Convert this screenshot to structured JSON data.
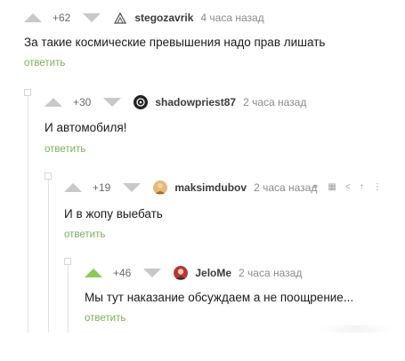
{
  "comments": [
    {
      "rating": "+62",
      "username": "stegozavrik",
      "time": "4 часа назад",
      "text": "За такие космические превышения надо прав лишать",
      "reply": "ответить"
    },
    {
      "rating": "+30",
      "username": "shadowpriest87",
      "time": "2 часа назад",
      "text": "И автомобиля!",
      "reply": "ответить"
    },
    {
      "rating": "+19",
      "username": "maksimdubov",
      "time": "2 часа назад",
      "text": "И в жопу выебать",
      "reply": "ответить"
    },
    {
      "rating": "+46",
      "username": "JeloMe",
      "time": "2 часа назад",
      "text": "Мы тут наказание обсуждаем а не поощрение...",
      "reply": "ответить"
    }
  ],
  "colors": {
    "vote_default": "#c8c8c8",
    "vote_up_active": "#8ac858",
    "reply_link": "#7cae5a"
  },
  "icons": [
    "arrow-up-icon",
    "arrow-down-icon",
    "link-icon",
    "save-icon",
    "share-icon",
    "expand-icon"
  ]
}
